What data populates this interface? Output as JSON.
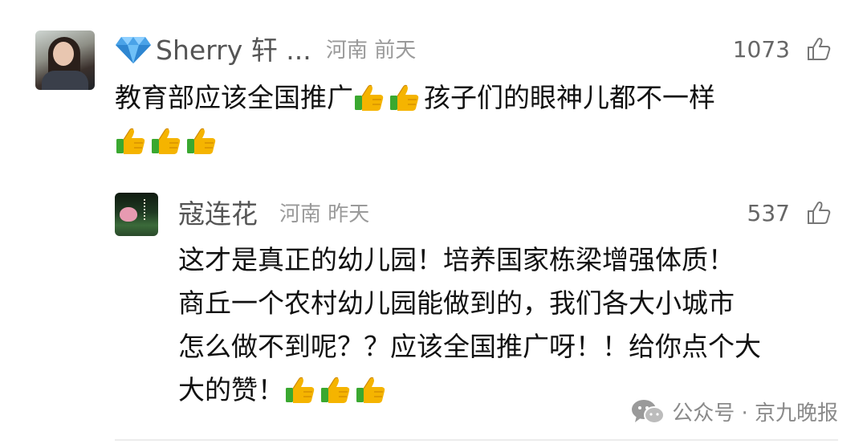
{
  "comments": [
    {
      "author": "Sherry 轩 ...",
      "location": "河南",
      "time": "前天",
      "likes": "1073",
      "text": "教育部应该全国推广",
      "text_after": "孩子们的眼神儿都不一样",
      "badge_icon": "diamond-icon"
    }
  ],
  "replies": [
    {
      "author": "寇连花",
      "location": "河南",
      "time": "昨天",
      "likes": "537",
      "lines": [
        "这才是真正的幼儿园！培养国家栋梁增强体质！",
        "商丘一个农村幼儿园能做到的，我们各大小城市",
        "怎么做不到呢？？应该全国推广呀！！给你点个大",
        "大的赞！"
      ]
    }
  ],
  "watermark": {
    "text": "公众号 · 京九晚报",
    "icon": "wechat-icon"
  },
  "colors": {
    "accent_thumb": "#f5b400",
    "thumb_cuff": "#3aa830",
    "gem": "#4aa3e8"
  }
}
